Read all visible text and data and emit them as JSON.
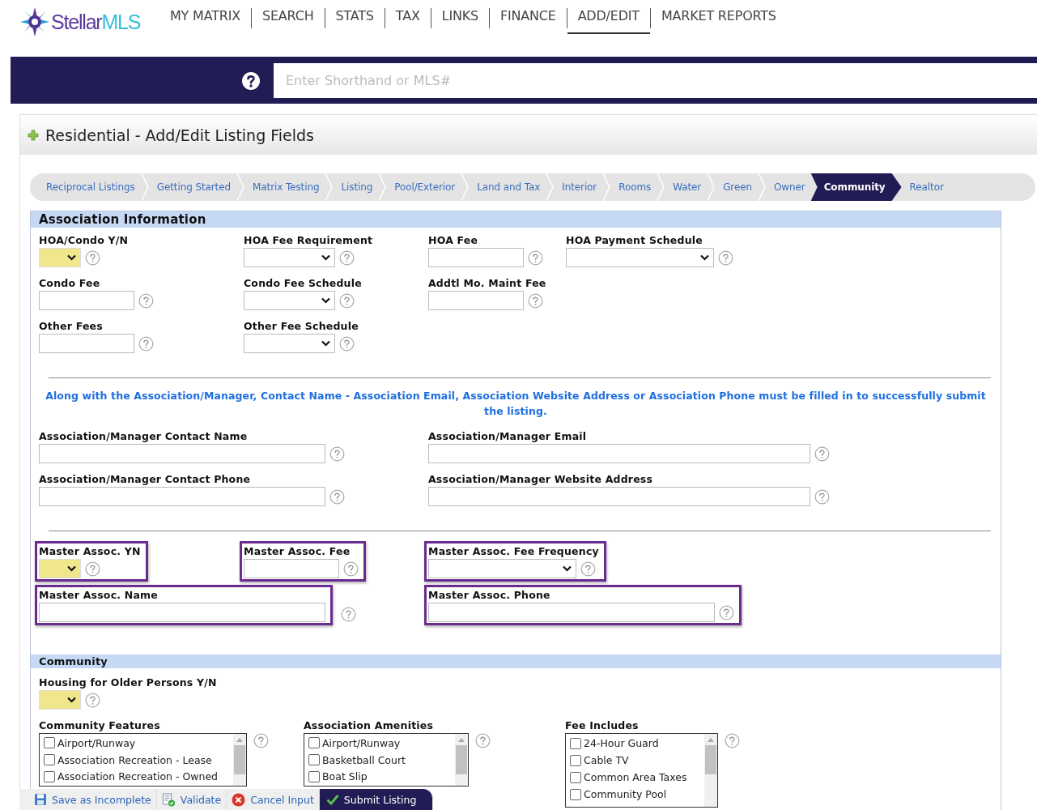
{
  "logo": {
    "brand": "Stellar",
    "suffix": "MLS"
  },
  "nav": [
    {
      "label": "MY MATRIX",
      "selected": false
    },
    {
      "label": "SEARCH",
      "selected": false
    },
    {
      "label": "STATS",
      "selected": false
    },
    {
      "label": "TAX",
      "selected": false
    },
    {
      "label": "LINKS",
      "selected": false
    },
    {
      "label": "FINANCE",
      "selected": false
    },
    {
      "label": "ADD/EDIT",
      "selected": true
    },
    {
      "label": "MARKET REPORTS",
      "selected": false
    }
  ],
  "search": {
    "placeholder": "Enter Shorthand or MLS#"
  },
  "page_title": "Residential - Add/Edit Listing Fields",
  "steps": [
    {
      "label": "Reciprocal Listings",
      "selected": false
    },
    {
      "label": "Getting Started",
      "selected": false
    },
    {
      "label": "Matrix Testing",
      "selected": false
    },
    {
      "label": "Listing",
      "selected": false
    },
    {
      "label": "Pool/Exterior",
      "selected": false
    },
    {
      "label": "Land and Tax",
      "selected": false
    },
    {
      "label": "Interior",
      "selected": false
    },
    {
      "label": "Rooms",
      "selected": false
    },
    {
      "label": "Water",
      "selected": false
    },
    {
      "label": "Green",
      "selected": false
    },
    {
      "label": "Owner",
      "selected": false
    },
    {
      "label": "Community",
      "selected": true
    },
    {
      "label": "Realtor",
      "selected": false
    }
  ],
  "association": {
    "title": "Association Information",
    "blocks": [
      {
        "kind": "fees",
        "rows": [
          [
            {
              "label": "HOA/Condo Y/N",
              "kind": "select",
              "required": true,
              "highlighted": false
            },
            {
              "label": "HOA Fee Requirement",
              "kind": "select",
              "required": false,
              "highlighted": false
            },
            {
              "label": "HOA Fee",
              "kind": "text",
              "required": false,
              "highlighted": false
            },
            {
              "label": "HOA Payment Schedule",
              "kind": "select",
              "required": false,
              "highlighted": false
            }
          ],
          [
            {
              "label": "Condo Fee",
              "kind": "text",
              "required": false,
              "highlighted": false
            },
            {
              "label": "Condo Fee Schedule",
              "kind": "select",
              "required": false,
              "highlighted": false
            },
            {
              "label": "Addtl Mo. Maint Fee",
              "kind": "text",
              "required": false,
              "highlighted": false
            }
          ],
          [
            {
              "label": "Other Fees",
              "kind": "text",
              "required": false,
              "highlighted": false
            },
            {
              "label": "Other Fee Schedule",
              "kind": "select",
              "required": false,
              "highlighted": false
            }
          ]
        ]
      },
      {
        "kind": "notice",
        "text": "Along with the Association/Manager, Contact Name - Association Email, Association Website Address or Association Phone must be filled in to successfully submit the listing."
      },
      {
        "kind": "contact",
        "rows": [
          [
            {
              "label": "Association/Manager Contact Name",
              "kind": "text",
              "required": false,
              "highlighted": false
            },
            {
              "label": "Association/Manager Email",
              "kind": "text",
              "required": false,
              "highlighted": false
            }
          ],
          [
            {
              "label": "Association/Manager Contact Phone",
              "kind": "text",
              "required": false,
              "highlighted": false
            },
            {
              "label": "Association/Manager Website Address",
              "kind": "text",
              "required": false,
              "highlighted": false
            }
          ]
        ]
      },
      {
        "kind": "master",
        "rows": [
          [
            {
              "label": "Master Assoc. YN",
              "kind": "select",
              "required": true,
              "highlighted": true
            },
            {
              "label": "Master Assoc. Fee",
              "kind": "text",
              "required": false,
              "highlighted": true
            },
            {
              "label": "Master Assoc. Fee Frequency",
              "kind": "select",
              "required": false,
              "highlighted": true
            }
          ],
          [
            {
              "label": "Master Assoc. Name",
              "kind": "text",
              "required": false,
              "highlighted": true
            },
            "",
            {
              "label": "Master Assoc. Phone",
              "kind": "text",
              "required": false,
              "highlighted": true
            }
          ]
        ]
      }
    ]
  },
  "community": {
    "title": "Community",
    "housing": {
      "label": "Housing for Older Persons Y/N",
      "kind": "select",
      "required": true
    },
    "lists": [
      {
        "label": "Community Features",
        "options": [
          {
            "label": "Airport/Runway",
            "checked": false
          },
          {
            "label": "Association Recreation - Lease",
            "checked": false
          },
          {
            "label": "Association Recreation - Owned",
            "checked": false
          }
        ]
      },
      {
        "label": "Association Amenities",
        "options": [
          {
            "label": "Airport/Runway",
            "checked": false
          },
          {
            "label": "Basketball Court",
            "checked": false
          },
          {
            "label": "Boat Slip",
            "checked": false
          }
        ]
      },
      {
        "label": "Fee Includes",
        "options": [
          {
            "label": "24-Hour Guard",
            "checked": false
          },
          {
            "label": "Cable TV",
            "checked": false
          },
          {
            "label": "Common Area Taxes",
            "checked": false
          },
          {
            "label": "Community Pool",
            "checked": false
          }
        ]
      }
    ]
  },
  "actions": [
    {
      "label": "Save as Incomplete",
      "kind": "save"
    },
    {
      "label": "Validate",
      "kind": "validate"
    },
    {
      "label": "Cancel Input",
      "kind": "cancel"
    },
    {
      "label": "Submit Listing",
      "kind": "submit"
    }
  ]
}
